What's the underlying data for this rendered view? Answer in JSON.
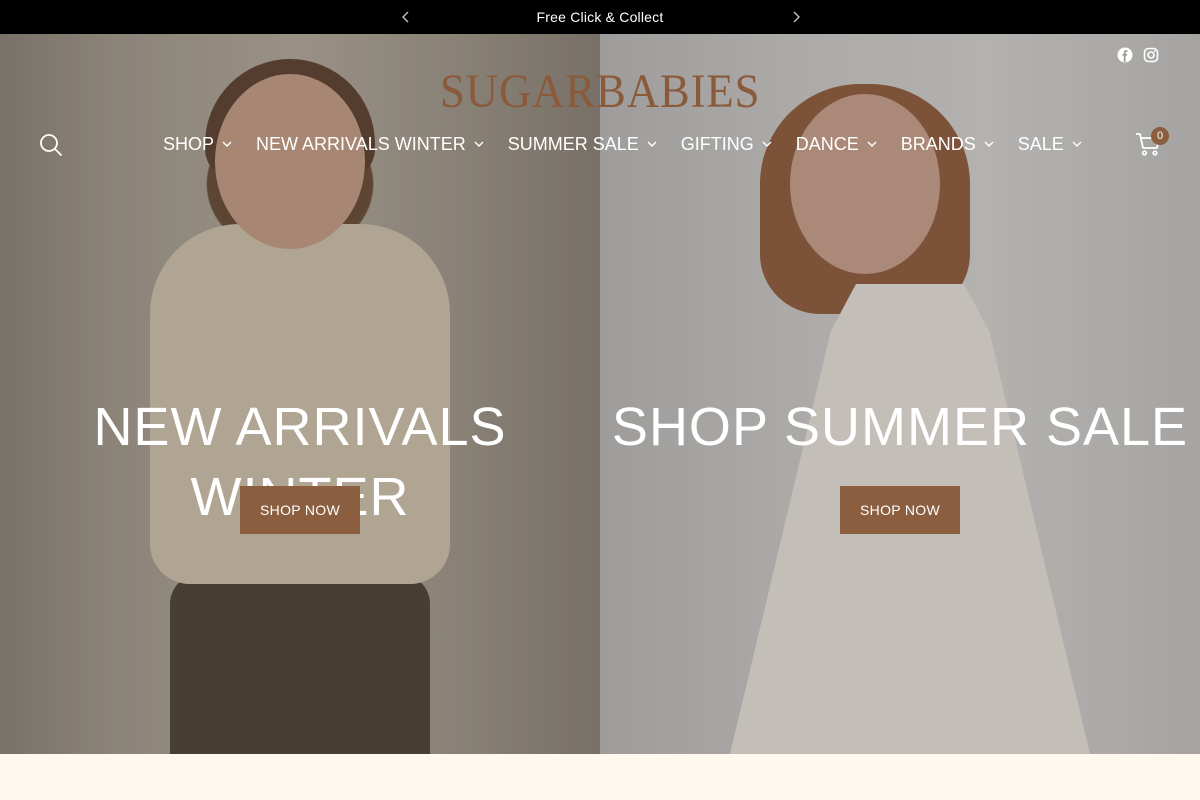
{
  "announcement": {
    "text": "Free Click & Collect"
  },
  "header": {
    "logo": "SUGARBABIES",
    "cart_count": "0"
  },
  "nav": {
    "items": [
      {
        "label": "SHOP"
      },
      {
        "label": "NEW ARRIVALS WINTER"
      },
      {
        "label": "SUMMER SALE"
      },
      {
        "label": "GIFTING"
      },
      {
        "label": "DANCE"
      },
      {
        "label": "BRANDS"
      },
      {
        "label": "SALE"
      }
    ]
  },
  "hero": {
    "left": {
      "title": "NEW ARRIVALS WINTER",
      "button": "SHOP NOW"
    },
    "right": {
      "title": "SHOP SUMMER SALE",
      "button": "SHOP NOW"
    }
  },
  "colors": {
    "brand": "#8a5a3b",
    "button": "#8b5e3f",
    "announcement_bg": "#000000",
    "page_bg": "#fff8ef"
  },
  "icons": [
    "chevron-left-icon",
    "chevron-right-icon",
    "facebook-icon",
    "instagram-icon",
    "search-icon",
    "cart-icon",
    "chevron-down-icon"
  ]
}
